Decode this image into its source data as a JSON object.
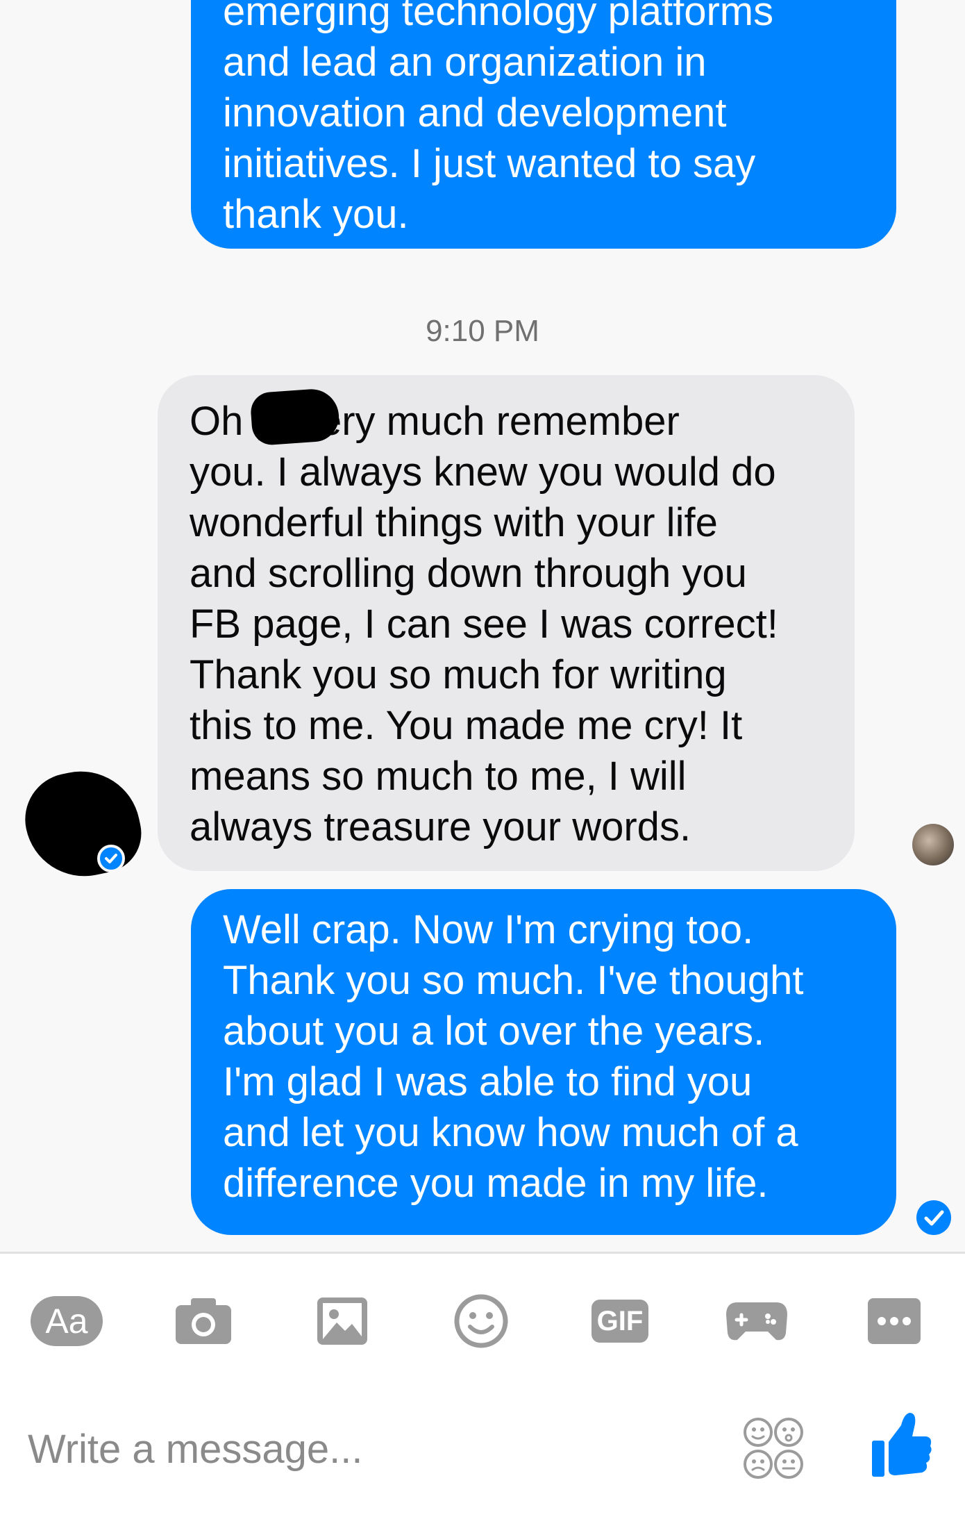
{
  "conversation": {
    "messages": [
      {
        "direction": "outgoing",
        "text": "emerging technology platforms\nand lead an organization in\ninnovation and development\ninitiatives. I just wanted to say\nthank you."
      },
      {
        "direction": "incoming",
        "text": "Oh        , I very much remember\nyou. I always knew you would do\nwonderful things with your life\nand scrolling down through you\nFB page, I can see I was correct!\nThank you so much for writing\nthis to me. You made me cry!  It\nmeans so much to me, I will\nalways treasure your words."
      },
      {
        "direction": "outgoing",
        "text": "Well crap. Now I'm crying too.\nThank you so much. I've thought\nabout you a lot over the years.\nI'm glad I was able to find you\nand let you know how much of a\ndifference you made in my life."
      }
    ],
    "timestamp": "9:10 PM"
  },
  "toolbar": {
    "text_style_label": "Aa",
    "gif_label": "GIF",
    "icons": [
      "text-style-icon",
      "camera-icon",
      "gallery-icon",
      "emoji-icon",
      "gif-icon",
      "game-controller-icon",
      "more-icon"
    ]
  },
  "composer": {
    "placeholder": "Write a message...",
    "icons": [
      "emoji-faces-icon",
      "thumbs-up-icon"
    ]
  },
  "colors": {
    "outgoing_bubble": "#0084ff",
    "incoming_bubble": "#e9e9eb",
    "icon_gray": "#9b9b9b",
    "like_blue": "#0084ff"
  }
}
